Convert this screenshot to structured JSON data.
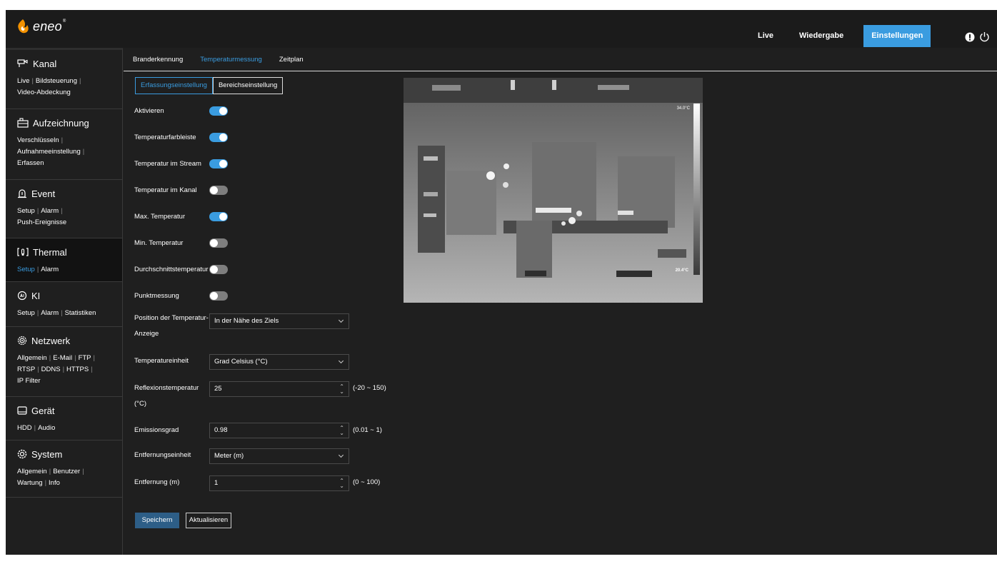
{
  "brand": {
    "name": "eneo",
    "mark": "®"
  },
  "topnav": {
    "live": "Live",
    "playback": "Wiedergabe",
    "settings": "Einstellungen"
  },
  "sidebar": {
    "kanal": {
      "title": "Kanal",
      "links": [
        "Live",
        "Bildsteuerung",
        "Video-Abdeckung"
      ]
    },
    "aufzeichnung": {
      "title": "Aufzeichnung",
      "links": [
        "Verschlüsseln",
        "Aufnahmeeinstellung",
        "Erfassen"
      ]
    },
    "event": {
      "title": "Event",
      "links": [
        "Setup",
        "Alarm",
        "Push-Ereignisse"
      ]
    },
    "thermal": {
      "title": "Thermal",
      "links": [
        "Setup",
        "Alarm"
      ]
    },
    "ki": {
      "title": "KI",
      "links": [
        "Setup",
        "Alarm",
        "Statistiken"
      ]
    },
    "netzwerk": {
      "title": "Netzwerk",
      "links": [
        "Allgemein",
        "E-Mail",
        "FTP",
        "RTSP",
        "DDNS",
        "HTTPS",
        "IP Filter"
      ]
    },
    "geraet": {
      "title": "Gerät",
      "links": [
        "HDD",
        "Audio"
      ]
    },
    "system": {
      "title": "System",
      "links": [
        "Allgemein",
        "Benutzer",
        "Wartung",
        "Info"
      ]
    }
  },
  "subtabs": [
    "Branderkennung",
    "Temperaturmessung",
    "Zeitplan"
  ],
  "modes": {
    "capture": "Erfassungseinstellung",
    "area": "Bereichseinstellung"
  },
  "toggles": [
    {
      "label": "Aktivieren",
      "on": true
    },
    {
      "label": "Temperaturfarbleiste",
      "on": true
    },
    {
      "label": "Temperatur im Stream",
      "on": true
    },
    {
      "label": "Temperatur im Kanal",
      "on": false
    },
    {
      "label": "Max. Temperatur",
      "on": true
    },
    {
      "label": "Min. Temperatur",
      "on": false
    },
    {
      "label": "Durchschnittstemperatur",
      "on": false
    },
    {
      "label": "Punktmessung",
      "on": false
    }
  ],
  "fields": {
    "position": {
      "label1": "Position der Temperatur-",
      "label2": "Anzeige",
      "value": "In der Nähe des Ziels"
    },
    "unit": {
      "label": "Temperatureinheit",
      "value": "Grad Celsius (°C)"
    },
    "reflection": {
      "label1": "Reflexionstemperatur",
      "label2": "(°C)",
      "value": "25",
      "range": "(-20 ~ 150)"
    },
    "emissivity": {
      "label": "Emissionsgrad",
      "value": "0.98",
      "range": "(0.01 ~ 1)"
    },
    "distance_unit": {
      "label": "Entfernungseinheit",
      "value": "Meter (m)"
    },
    "distance": {
      "label": "Entfernung (m)",
      "value": "1",
      "range": "(0 ~ 100)"
    }
  },
  "buttons": {
    "save": "Speichern",
    "refresh": "Aktualisieren"
  },
  "camera": {
    "max_temp": "34.0°C",
    "min_temp": "20.4°C"
  },
  "colors": {
    "accent": "#3a9ce0",
    "save": "#2d5e87",
    "logo_orange": "#f39200"
  }
}
